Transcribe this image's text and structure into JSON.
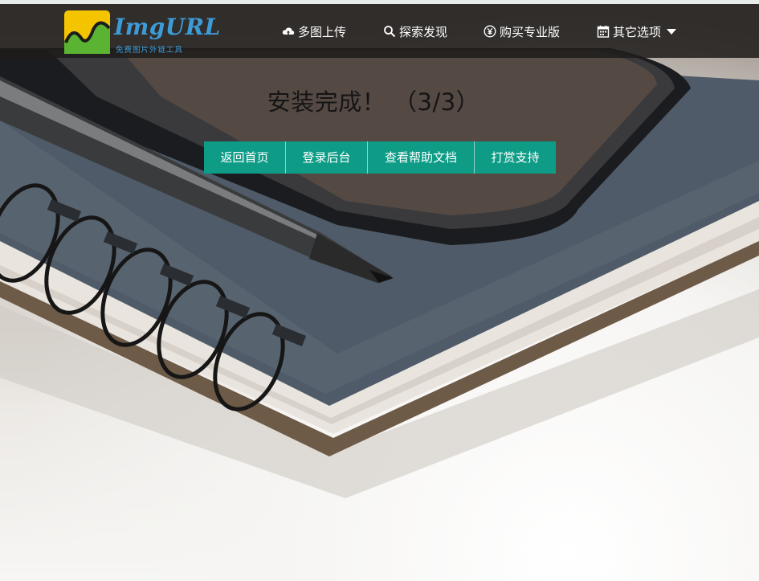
{
  "brand": {
    "name": "ImgURL",
    "tagline": "免费图片外链工具"
  },
  "nav": {
    "items": [
      {
        "label": "多图上传",
        "icon": "cloud-upload-icon"
      },
      {
        "label": "探索发现",
        "icon": "search-icon"
      },
      {
        "label": "购买专业版",
        "icon": "yen-coin-icon"
      },
      {
        "label": "其它选项",
        "icon": "calendar-icon",
        "has_dropdown": true
      }
    ]
  },
  "main": {
    "title": "安装完成！ （3/3）",
    "buttons": [
      {
        "label": "返回首页"
      },
      {
        "label": "登录后台"
      },
      {
        "label": "查看帮助文档"
      },
      {
        "label": "打赏支持"
      }
    ]
  },
  "colors": {
    "navbar_bg": "#1e1c1b",
    "accent": "#0e9c87",
    "logo_blue": "#3d9bd8",
    "logo_yellow": "#f5c400",
    "logo_green": "#5bb431"
  },
  "background": {
    "description_icon": "notebook-pencil-phone-photo"
  }
}
